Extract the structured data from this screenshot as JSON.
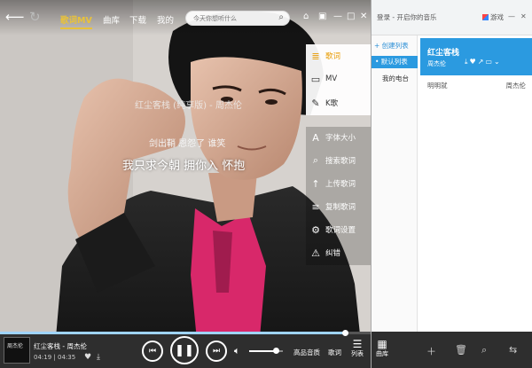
{
  "nav": {
    "tabs": [
      "歌词MV",
      "曲库",
      "下载",
      "我的"
    ],
    "search_placeholder": "今天你想听什么"
  },
  "lyrics": {
    "song_title": "红尘客栈 (纯享版) - 周杰伦",
    "prev_line": "剑出鞘 恩怨了 谁笑",
    "current_line": "我只求今朝 拥你入 怀抱"
  },
  "tools": {
    "top": [
      {
        "icon": "≣",
        "label": "歌词",
        "selected": true
      },
      {
        "icon": "▭",
        "label": "MV",
        "selected": false
      },
      {
        "icon": "✎",
        "label": "K歌",
        "selected": false
      }
    ],
    "bottom": [
      {
        "icon": "A",
        "label": "字体大小"
      },
      {
        "icon": "⌕",
        "label": "搜索歌词"
      },
      {
        "icon": "↑",
        "label": "上传歌词"
      },
      {
        "icon": "≡",
        "label": "复制歌词"
      },
      {
        "icon": "⚙",
        "label": "歌词设置"
      },
      {
        "icon": "⚠",
        "label": "纠错"
      }
    ]
  },
  "player": {
    "title": "红尘客栈 - 周杰伦",
    "elapsed": "04:19",
    "duration": "04:35",
    "progress": 0.93,
    "volume": 0.8,
    "quality_label": "高品音质",
    "lyric_label": "歌词",
    "playlist_label": "列表",
    "cover_text": "周杰伦"
  },
  "right_panel": {
    "login": "登录 - 开启你的音乐",
    "game": "游戏",
    "create_list": "+ 创建列表",
    "default_list": "• 默认列表",
    "my_radio": "我的电台",
    "selected_song": {
      "title": "红尘客栈",
      "artist": "周杰伦"
    },
    "songs": [
      {
        "name": "明明就",
        "artist": "周杰伦"
      }
    ],
    "library_label": "曲库"
  },
  "colors": {
    "accent": "#e9c23a",
    "blue": "#2b9ae0",
    "shirt": "#d8286a"
  }
}
